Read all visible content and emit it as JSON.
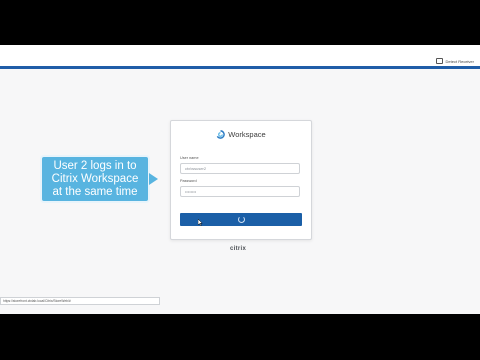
{
  "header": {
    "detect_link": "Detect Receiver",
    "accent_color": "#1f5da8"
  },
  "login_card": {
    "logo_icon": "workspace-swirl-icon",
    "title": "Workspace",
    "username_label": "User name",
    "username_value": "ctx\\wsuser2",
    "password_label": "Password",
    "password_value": "••••••••",
    "button_color": "#1b5fa7",
    "button_state": "loading"
  },
  "brand_footer": "citrix",
  "callout": {
    "lines": [
      "User 2 logs in to",
      "Citrix Workspace",
      "at the same time"
    ],
    "color": "#58b4e0"
  },
  "status_bar": {
    "url": "https://storefront.ctxlab.local/Citrix/StoreWeb/#"
  }
}
